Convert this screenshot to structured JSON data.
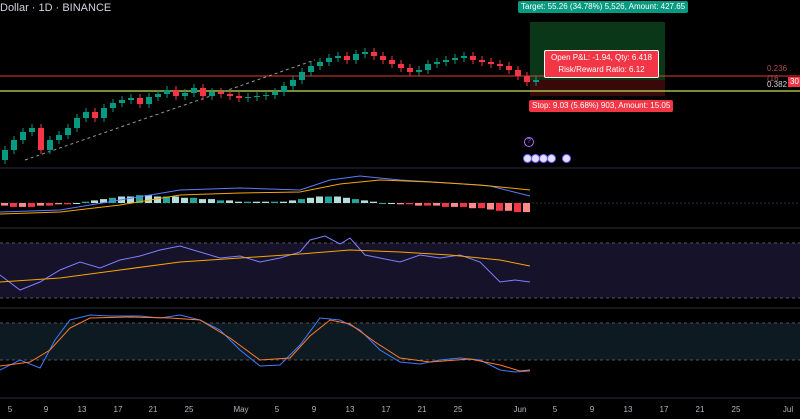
{
  "header": {
    "title": "Dollar · 1D · BINANCE"
  },
  "position": {
    "target_label": "Target: 55.26 (34.78%) 5,526, Amount: 427.65",
    "stop_label": "Stop: 9.03 (5.68%) 903, Amount: 15.05",
    "pnl_line1": "Open P&L: -1.94, Qty: 6.418",
    "pnl_line2": "Risk/Reward Ratio: 6.12"
  },
  "price_scale": {
    "fib_1": "0.236 (16",
    "fib_2": "0.382",
    "last_price": "30"
  },
  "x_axis": {
    "labels": [
      "5",
      "9",
      "13",
      "17",
      "21",
      "25",
      "May",
      "5",
      "9",
      "13",
      "17",
      "21",
      "25",
      "Jun",
      "5",
      "9",
      "13",
      "17",
      "21",
      "25",
      "Jul"
    ]
  },
  "colors": {
    "up": "#089981",
    "down": "#f23645",
    "ma": "#f7a600",
    "osc": "#5b7cff",
    "fib_red": "#e53935",
    "fib_green": "#c5e15a"
  },
  "icons": [
    "question-flag-icon",
    "us-flag-icon"
  ]
}
